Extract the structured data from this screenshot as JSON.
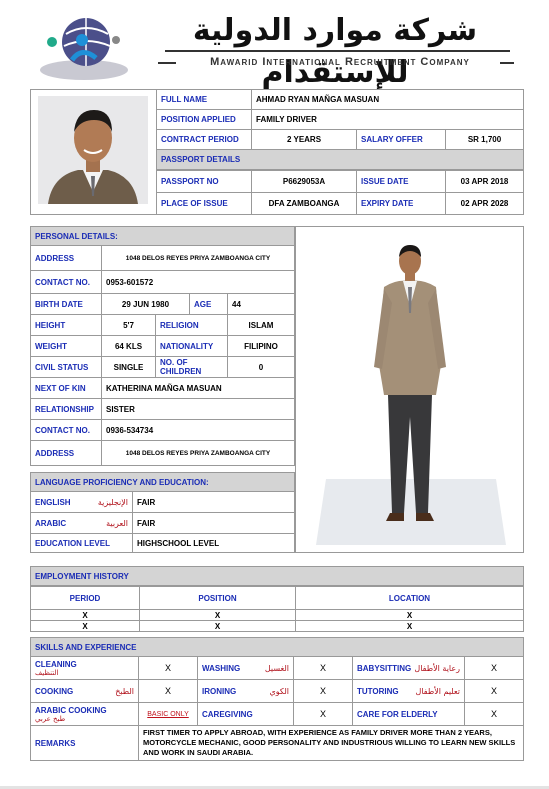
{
  "company": {
    "arabic_name": "شركة موارد الدولية للإستقدام",
    "english_name": "Mawarid International Recruitment Company"
  },
  "header_rows": [
    {
      "label": "FULL NAME",
      "value": "AHMAD RYAN MAÑGA MASUAN"
    },
    {
      "label": "POSITION APPLIED",
      "value": "FAMILY DRIVER"
    },
    {
      "label": "CONTRACT PERIOD",
      "value": "2 YEARS",
      "label2": "SALARY OFFER",
      "value2": "SR 1,700"
    },
    {
      "label": "PASSPORT DETAILS"
    },
    {
      "label": "PASSPORT NO",
      "value": "P6629053A",
      "label2": "ISSUE DATE",
      "value2": "03 APR 2018"
    },
    {
      "label": "PLACE OF ISSUE",
      "value": "DFA ZAMBOANGA",
      "label2": "EXPIRY DATE",
      "value2": "02 APR 2028"
    }
  ],
  "personal": {
    "title": "PERSONAL DETAILS:",
    "address_label": "ADDRESS",
    "address": "1048 DELOS REYES PRIYA ZAMBOANGA CITY",
    "contact_label": "CONTACT NO.",
    "contact": "0953-601572",
    "birth_label": "BIRTH  DATE",
    "birth": "29 JUN 1980",
    "age_label": "AGE",
    "age": "44",
    "height_label": "HEIGHT",
    "height": "5'7",
    "religion_label": "RELIGION",
    "religion": "ISLAM",
    "weight_label": "WEIGHT",
    "weight": "64 KLS",
    "nationality_label": "NATIONALITY",
    "nationality": "FILIPINO",
    "civil_label": "CIVIL STATUS",
    "civil": "SINGLE",
    "children_label": "NO. OF CHILDREN",
    "children": "0",
    "kin_label": "NEXT OF KIN",
    "kin": "KATHERINA MAÑGA MASUAN",
    "relationship_label": "RELATIONSHIP",
    "relationship": "SISTER",
    "contact2_label": "CONTACT NO.",
    "contact2": "0936-534734",
    "address2_label": "ADDRESS",
    "address2": "1048 DELOS REYES PRIYA ZAMBOANGA CITY"
  },
  "language": {
    "title": "LANGUAGE PROFICIENCY AND EDUCATION:",
    "english_label": "ENGLISH",
    "english_ar": "الإنجليزية",
    "english": "FAIR",
    "arabic_label": "ARABIC",
    "arabic_ar": "العربية",
    "arabic": "FAIR",
    "education_label": "EDUCATION LEVEL",
    "education": "HIGHSCHOOL LEVEL"
  },
  "employment": {
    "title": "EMPLOYMENT HISTORY",
    "headers": [
      "PERIOD",
      "POSITION",
      "LOCATION"
    ],
    "rows": [
      [
        "X",
        "X",
        "X"
      ],
      [
        "X",
        "X",
        "X"
      ]
    ]
  },
  "skills": {
    "title": "SKILLS AND EXPERIENCE",
    "cleaning": "CLEANING",
    "cleaning_ar": "التنظيف",
    "cleaning_v": "X",
    "washing": "WASHING",
    "washing_ar": "الغسيل",
    "washing_v": "X",
    "babysitting": "BABYSITTING",
    "babysitting_ar": "رعاية الأطفال",
    "babysitting_v": "X",
    "cooking": "COOKING",
    "cooking_ar": "الطبخ",
    "cooking_v": "X",
    "ironing": "IRONING",
    "ironing_ar": "الكوي",
    "ironing_v": "X",
    "tutoring": "TUTORING",
    "tutoring_ar": "تعليم الأطفال",
    "tutoring_v": "X",
    "arabic_cooking": "ARABIC COOKING",
    "arabic_cooking_ar": "طبخ عربي",
    "arabic_cooking_v": "BASIC ONLY",
    "caregiving": "CAREGIVING",
    "caregiving_v": "X",
    "elderly": "CARE FOR ELDERLY",
    "elderly_v": "X",
    "remarks_label": "REMARKS",
    "remarks": "FIRST TIMER TO APPLY ABROAD, WITH EXPERIENCE AS FAMILY DRIVER MORE THAN 2 YEARS, MOTORCYCLE MECHANIC, GOOD PERSONALITY AND INDUSTRIOUS WILLING TO LEARN NEW SKILLS AND WORK IN SAUDI ARABIA."
  },
  "colors": {
    "label_blue": "#1a2cb5",
    "header_grey": "#d4d4d4",
    "arabic_red": "#b0101a"
  }
}
